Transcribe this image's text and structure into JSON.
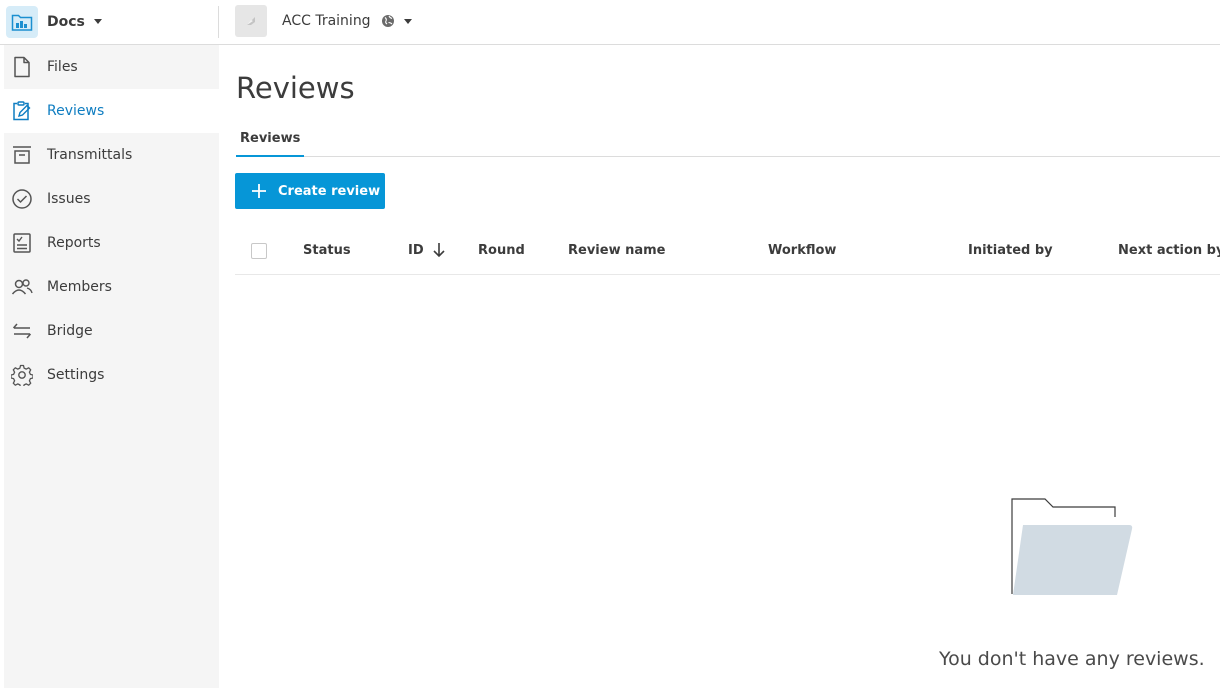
{
  "topbar": {
    "module_name": "Docs",
    "project_name": "ACC Training"
  },
  "sidebar": {
    "items": [
      {
        "label": "Files",
        "icon": "file-icon"
      },
      {
        "label": "Reviews",
        "icon": "reviews-icon",
        "active": true
      },
      {
        "label": "Transmittals",
        "icon": "transmittals-icon"
      },
      {
        "label": "Issues",
        "icon": "issues-icon"
      },
      {
        "label": "Reports",
        "icon": "reports-icon"
      },
      {
        "label": "Members",
        "icon": "members-icon"
      },
      {
        "label": "Bridge",
        "icon": "bridge-icon"
      },
      {
        "label": "Settings",
        "icon": "gear-icon"
      }
    ]
  },
  "main": {
    "title": "Reviews",
    "tabs": [
      {
        "label": "Reviews",
        "active": true
      }
    ],
    "create_button_label": "Create review",
    "table": {
      "columns": [
        "Status",
        "ID",
        "Round",
        "Review name",
        "Workflow",
        "Initiated by",
        "Next action by"
      ],
      "sort_column": "ID",
      "sort_direction": "descending"
    },
    "empty_message": "You don't have any reviews."
  },
  "colors": {
    "accent": "#0696d7",
    "active_nav_text": "#0f7dc1",
    "sidebar_bg": "#f5f5f5",
    "empty_folder": "#d1dbe3"
  }
}
